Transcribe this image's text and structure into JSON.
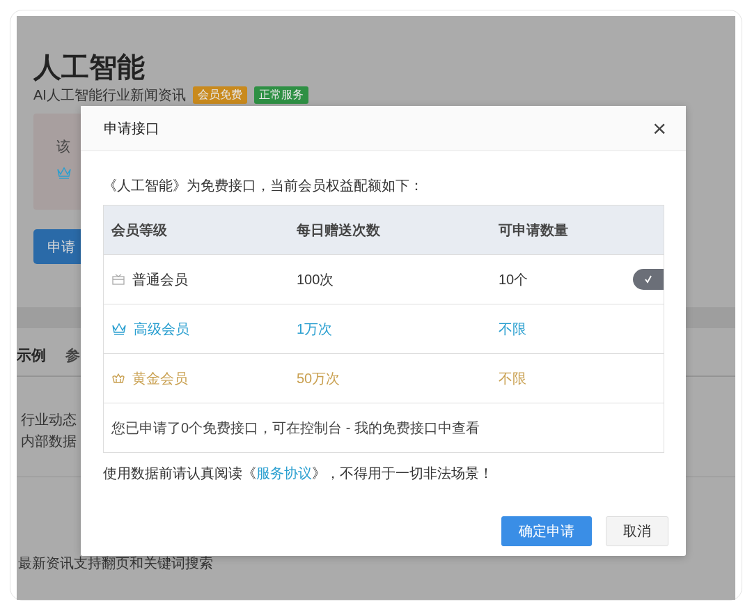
{
  "page": {
    "title": "人工智能",
    "subtitle": "AI人工智能行业新闻资讯",
    "badges": [
      {
        "label": "会员免费",
        "color": "#c98a1d"
      },
      {
        "label": "正常服务",
        "color": "#2e9044"
      }
    ],
    "notice": {
      "text": "该"
    },
    "apply_button": "申请",
    "tabs": [
      {
        "label": "示例",
        "selected": true
      },
      {
        "label": "参",
        "selected": false
      }
    ],
    "lines": [
      "行业动态",
      "内部数据"
    ],
    "section_text": "最新资讯支持翻页和关键词搜索"
  },
  "dialog": {
    "title": "申请接口",
    "close": "×",
    "intro": "《人工智能》为免费接口，当前会员权益配额如下：",
    "table": {
      "columns": [
        "会员等级",
        "每日赠送次数",
        "可申请数量"
      ],
      "rows": [
        {
          "kind": "gift",
          "tier": "普通会员",
          "daily": "100次",
          "quota": "10个",
          "color": "#333333",
          "current": true
        },
        {
          "kind": "crown",
          "tier": "高级会员",
          "daily": "1万次",
          "quota": "不限",
          "color": "#2a9fd0",
          "current": false
        },
        {
          "kind": "royal",
          "tier": "黄金会员",
          "daily": "50万次",
          "quota": "不限",
          "color": "#c9a050",
          "current": false
        }
      ],
      "footer": "您已申请了0个免费接口，可在控制台 - 我的免费接口中查看"
    },
    "agreement": {
      "before": "使用数据前请认真阅读《",
      "link": "服务协议",
      "after": "》，不得用于一切非法场景！"
    },
    "buttons": [
      {
        "label": "确定申请",
        "kind": "primary"
      },
      {
        "label": "取消",
        "kind": "default"
      }
    ]
  }
}
